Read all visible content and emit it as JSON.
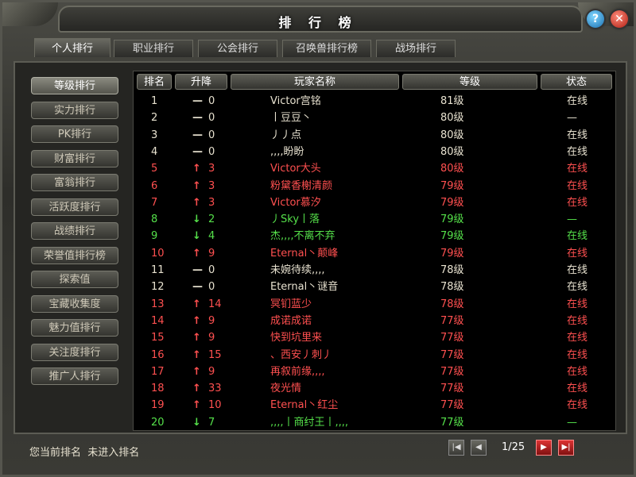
{
  "window": {
    "title": "排 行 榜"
  },
  "colors": {
    "white": "#e8e2d0",
    "red": "#ff5050",
    "green": "#55e04a"
  },
  "tabs": [
    {
      "label": "个人排行",
      "active": true
    },
    {
      "label": "职业排行"
    },
    {
      "label": "公会排行"
    },
    {
      "label": "召唤兽排行榜"
    },
    {
      "label": "战场排行"
    }
  ],
  "sidebar": [
    {
      "label": "等级排行",
      "active": true
    },
    {
      "label": "实力排行"
    },
    {
      "label": "PK排行"
    },
    {
      "label": "财富排行"
    },
    {
      "label": "富翁排行"
    },
    {
      "label": "活跃度排行"
    },
    {
      "label": "战绩排行"
    },
    {
      "label": "荣誉值排行榜"
    },
    {
      "label": "探索值"
    },
    {
      "label": "宝藏收集度"
    },
    {
      "label": "魅力值排行"
    },
    {
      "label": "关注度排行"
    },
    {
      "label": "推广人排行"
    }
  ],
  "columns": {
    "rank": "排名",
    "change": "升降",
    "name": "玩家名称",
    "level": "等级",
    "status": "状态"
  },
  "rows": [
    {
      "rank": "1",
      "arrow": "—",
      "delta": "0",
      "name": "Victor宫铭",
      "level": "81级",
      "status": "在线",
      "color": "white"
    },
    {
      "rank": "2",
      "arrow": "—",
      "delta": "0",
      "name": "丨豆豆丶",
      "level": "80级",
      "status": "—",
      "color": "white"
    },
    {
      "rank": "3",
      "arrow": "—",
      "delta": "0",
      "name": "丿丿点",
      "level": "80级",
      "status": "在线",
      "color": "white"
    },
    {
      "rank": "4",
      "arrow": "—",
      "delta": "0",
      "name": ",,,,盼盼",
      "level": "80级",
      "status": "在线",
      "color": "white"
    },
    {
      "rank": "5",
      "arrow": "↑",
      "delta": "3",
      "name": "Victor大头",
      "level": "80级",
      "status": "在线",
      "color": "red"
    },
    {
      "rank": "6",
      "arrow": "↑",
      "delta": "3",
      "name": "粉黛香榭清颜",
      "level": "79级",
      "status": "在线",
      "color": "red"
    },
    {
      "rank": "7",
      "arrow": "↑",
      "delta": "3",
      "name": "Victor慕汐",
      "level": "79级",
      "status": "在线",
      "color": "red"
    },
    {
      "rank": "8",
      "arrow": "↓",
      "delta": "2",
      "name": "丿Sky丨落",
      "level": "79级",
      "status": "—",
      "color": "green"
    },
    {
      "rank": "9",
      "arrow": "↓",
      "delta": "4",
      "name": "杰,,,,不离不弃",
      "level": "79级",
      "status": "在线",
      "color": "green"
    },
    {
      "rank": "10",
      "arrow": "↑",
      "delta": "9",
      "name": "Eternal丶颠峰",
      "level": "79级",
      "status": "在线",
      "color": "red"
    },
    {
      "rank": "11",
      "arrow": "—",
      "delta": "0",
      "name": "未婉待续,,,,",
      "level": "78级",
      "status": "在线",
      "color": "white"
    },
    {
      "rank": "12",
      "arrow": "—",
      "delta": "0",
      "name": "Eternal丶谜音",
      "level": "78级",
      "status": "在线",
      "color": "white"
    },
    {
      "rank": "13",
      "arrow": "↑",
      "delta": "14",
      "name": "冥钔蓝少",
      "level": "78级",
      "status": "在线",
      "color": "red"
    },
    {
      "rank": "14",
      "arrow": "↑",
      "delta": "9",
      "name": "成诺成诺",
      "level": "77级",
      "status": "在线",
      "color": "red"
    },
    {
      "rank": "15",
      "arrow": "↑",
      "delta": "9",
      "name": "快到坑里来",
      "level": "77级",
      "status": "在线",
      "color": "red"
    },
    {
      "rank": "16",
      "arrow": "↑",
      "delta": "15",
      "name": "、西安丿刺丿",
      "level": "77级",
      "status": "在线",
      "color": "red"
    },
    {
      "rank": "17",
      "arrow": "↑",
      "delta": "9",
      "name": "再叙前缘,,,,",
      "level": "77级",
      "status": "在线",
      "color": "red"
    },
    {
      "rank": "18",
      "arrow": "↑",
      "delta": "33",
      "name": "夜光情",
      "level": "77级",
      "status": "在线",
      "color": "red"
    },
    {
      "rank": "19",
      "arrow": "↑",
      "delta": "10",
      "name": "Eternal丶红尘",
      "level": "77级",
      "status": "在线",
      "color": "red"
    },
    {
      "rank": "20",
      "arrow": "↓",
      "delta": "7",
      "name": ",,,,丨商纣王丨,,,,",
      "level": "77级",
      "status": "—",
      "color": "green"
    }
  ],
  "footer": {
    "current_rank_label": "您当前排名",
    "current_rank_value": "未进入排名",
    "page": "1/25"
  },
  "icons": {
    "help": "?",
    "close": "✕",
    "first": "first-page-icon",
    "prev": "prev-page-icon",
    "next": "next-page-icon",
    "last": "last-page-icon"
  }
}
